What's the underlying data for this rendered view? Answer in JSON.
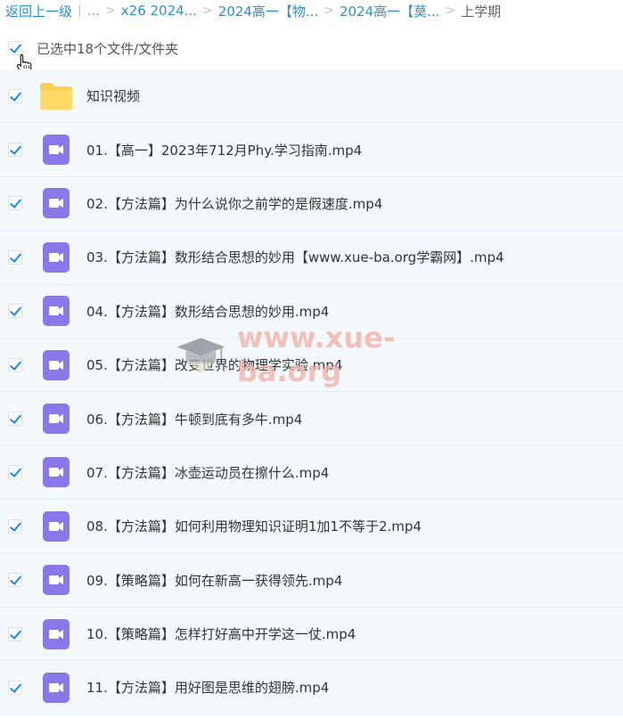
{
  "breadcrumb": {
    "back_label": "返回上一级",
    "separator": "|",
    "ellipsis": "...",
    "chevron": ">",
    "crumbs": [
      "x26 2024...",
      "2024高一【物...",
      "2024高一【莫..."
    ],
    "current": "上学期"
  },
  "selection": {
    "checked": true,
    "text": "已选中18个文件/文件夹"
  },
  "files": [
    {
      "name": "知识视频",
      "type": "folder"
    },
    {
      "name": "01.【高一】2023年712月Phy.学习指南.mp4",
      "type": "video"
    },
    {
      "name": "02.【方法篇】为什么说你之前学的是假速度.mp4",
      "type": "video"
    },
    {
      "name": "03.【方法篇】数形结合思想的妙用【www.xue-ba.org学霸网】.mp4",
      "type": "video"
    },
    {
      "name": "04.【方法篇】数形结合思想的妙用.mp4",
      "type": "video"
    },
    {
      "name": "05.【方法篇】改变世界的物理学实验.mp4",
      "type": "video"
    },
    {
      "name": "06.【方法篇】牛顿到底有多牛.mp4",
      "type": "video"
    },
    {
      "name": "07.【方法篇】冰壶运动员在擦什么.mp4",
      "type": "video"
    },
    {
      "name": "08.【方法篇】如何利用物理知识证明1加1不等于2.mp4",
      "type": "video"
    },
    {
      "name": "09.【策略篇】如何在新高一获得领先.mp4",
      "type": "video"
    },
    {
      "name": "10.【策略篇】怎样打好高中开学这一仗.mp4",
      "type": "video"
    },
    {
      "name": "11.【方法篇】用好图是思维的翅膀.mp4",
      "type": "video"
    }
  ],
  "watermark": {
    "text": "www.xue-ba.org"
  },
  "colors": {
    "link": "#2a8fd4",
    "checkbox_check": "#1a8ae8",
    "folder": "#ffd04d",
    "video": "#8a78e8",
    "row_bg": "#f4f9fe"
  },
  "icons": {
    "folder": "folder-icon",
    "video": "video-file-icon",
    "cursor": "hand-pointer-icon",
    "watermark_logo": "graduation-cap-icon"
  }
}
